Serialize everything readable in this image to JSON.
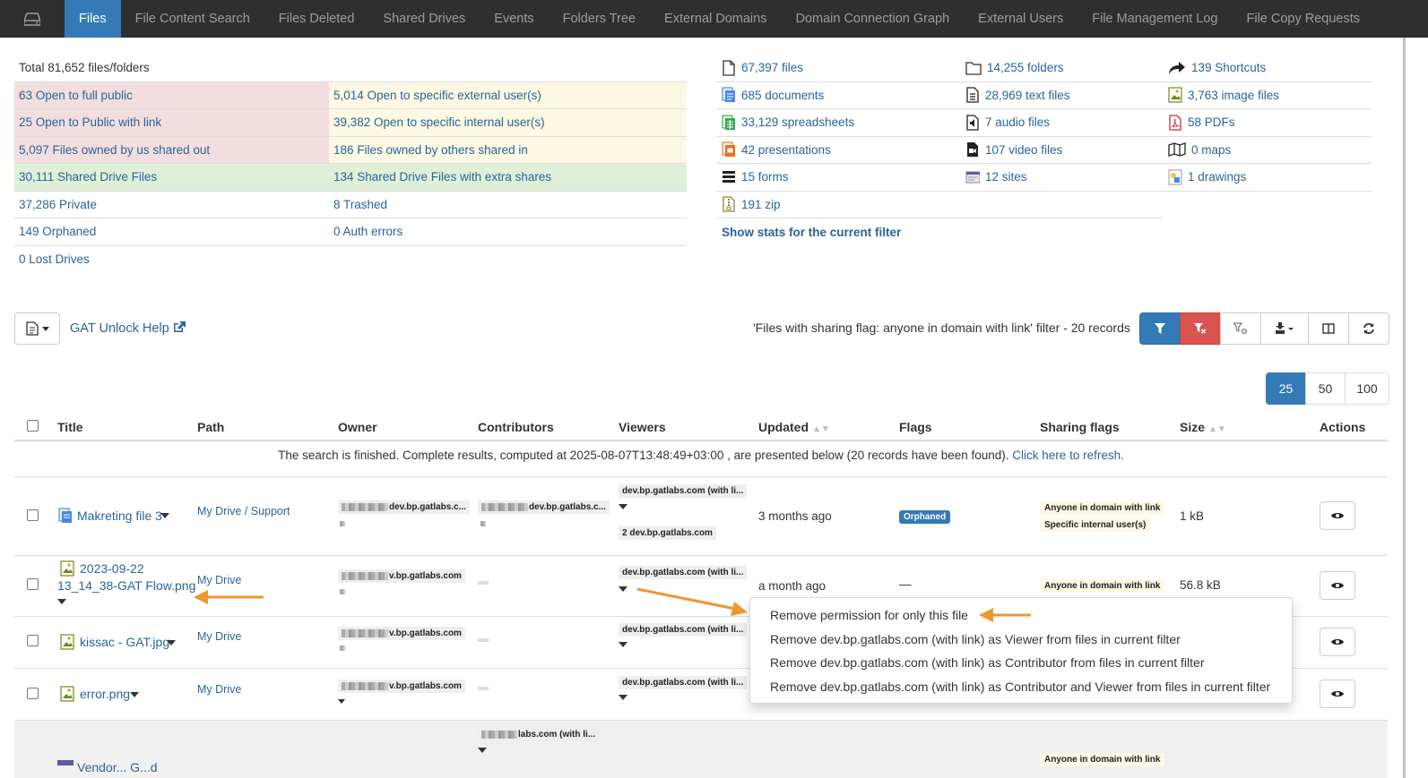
{
  "nav": {
    "tabs": [
      {
        "label": "Files",
        "active": true
      },
      {
        "label": "File Content Search"
      },
      {
        "label": "Files Deleted"
      },
      {
        "label": "Shared Drives"
      },
      {
        "label": "Events"
      },
      {
        "label": "Folders Tree"
      },
      {
        "label": "External Domains"
      },
      {
        "label": "Domain Connection Graph"
      },
      {
        "label": "External Users"
      },
      {
        "label": "File Management Log"
      },
      {
        "label": "File Copy Requests"
      }
    ]
  },
  "stats": {
    "total": "Total 81,652 files/folders",
    "rows": [
      [
        "63 Open to full public",
        "5,014 Open to specific external user(s)"
      ],
      [
        "25 Open to Public with link",
        "39,382 Open to specific internal user(s)"
      ],
      [
        "5,097 Files owned by us shared out",
        "186 Files owned by others shared in"
      ],
      [
        "30,111 Shared Drive Files",
        "134 Shared Drive Files with extra shares"
      ],
      [
        "37,286 Private",
        "8 Trashed"
      ],
      [
        "149 Orphaned",
        "0 Auth errors"
      ],
      [
        "0 Lost Drives",
        ""
      ]
    ]
  },
  "types": {
    "rows": [
      [
        "67,397 files",
        "14,255 folders",
        "139 Shortcuts"
      ],
      [
        "685 documents",
        "28,969 text files",
        "3,763 image files"
      ],
      [
        "33,129 spreadsheets",
        "7 audio files",
        "58 PDFs"
      ],
      [
        "42 presentations",
        "107 video files",
        "0 maps"
      ],
      [
        "15 forms",
        "12 sites",
        "1 drawings"
      ],
      [
        "191 zip"
      ]
    ],
    "show_stats": "Show stats for the current filter"
  },
  "toolbar": {
    "help": "GAT Unlock Help",
    "filter_text": "'Files with sharing flag: anyone in domain with link' filter -  20 records"
  },
  "pager": [
    "25",
    "50",
    "100"
  ],
  "table": {
    "headers": {
      "title": "Title",
      "path": "Path",
      "owner": "Owner",
      "contributors": "Contributors",
      "viewers": "Viewers",
      "updated": "Updated",
      "flags": "Flags",
      "sharing": "Sharing flags",
      "size": "Size",
      "actions": "Actions"
    },
    "notice": "The search is finished. Complete results, computed at 2025-08-07T13:48:49+03:00 , are presented below (20 records have been found).",
    "refresh": "Click here to refresh.",
    "rows": [
      {
        "title": "Makreting file 3",
        "path1": "My Drive",
        "path_sep": " / ",
        "path2": "Support",
        "owner": "dev.bp.gatlabs.c...",
        "contrib": "dev.bp.gatlabs.c...",
        "viewer1": "dev.bp.gatlabs.com (with li...",
        "viewer2": "2 dev.bp.gatlabs.com",
        "updated": "3 months ago",
        "flag": "Orphaned",
        "sharing1": "Anyone in domain with link",
        "sharing2": "Specific internal user(s)",
        "size": "1 kB"
      },
      {
        "title1": "2023-09-22",
        "title2": "13_14_38-GAT Flow.png",
        "path1": "My Drive",
        "owner": "v.bp.gatlabs.com",
        "viewer1": "dev.bp.gatlabs.com (with li...",
        "updated": "a month ago",
        "flag": "—",
        "sharing1": "Anyone in domain with link",
        "size": "56.8 kB"
      },
      {
        "title": "kissac - GAT.jpg",
        "path1": "My Drive",
        "owner": "v.bp.gatlabs.com",
        "viewer1": "dev.bp.gatlabs.com (with li..."
      },
      {
        "title": "error.png",
        "path1": "My Drive",
        "owner": "v.bp.gatlabs.com",
        "viewer1": "dev.bp.gatlabs.com (with li..."
      },
      {
        "title": "Vendor... G...d",
        "contrib": "labs.com (with li...",
        "sharing1": "Anyone in domain with link"
      }
    ]
  },
  "dropdown": {
    "items": [
      "Remove permission for only this file",
      "Remove dev.bp.gatlabs.com (with link) as Viewer from files in current filter",
      "Remove dev.bp.gatlabs.com (with link) as Contributor from files in current filter",
      "Remove dev.bp.gatlabs.com (with link) as Contributor and Viewer from files in current filter"
    ]
  },
  "colors": {
    "nav_bg": "#2f2f2f",
    "primary": "#337ab7",
    "danger": "#d9534f",
    "public": "#f2dede",
    "external": "#fcf8e3",
    "shared_drive": "#dff0d8",
    "arrow": "#f0962e"
  }
}
